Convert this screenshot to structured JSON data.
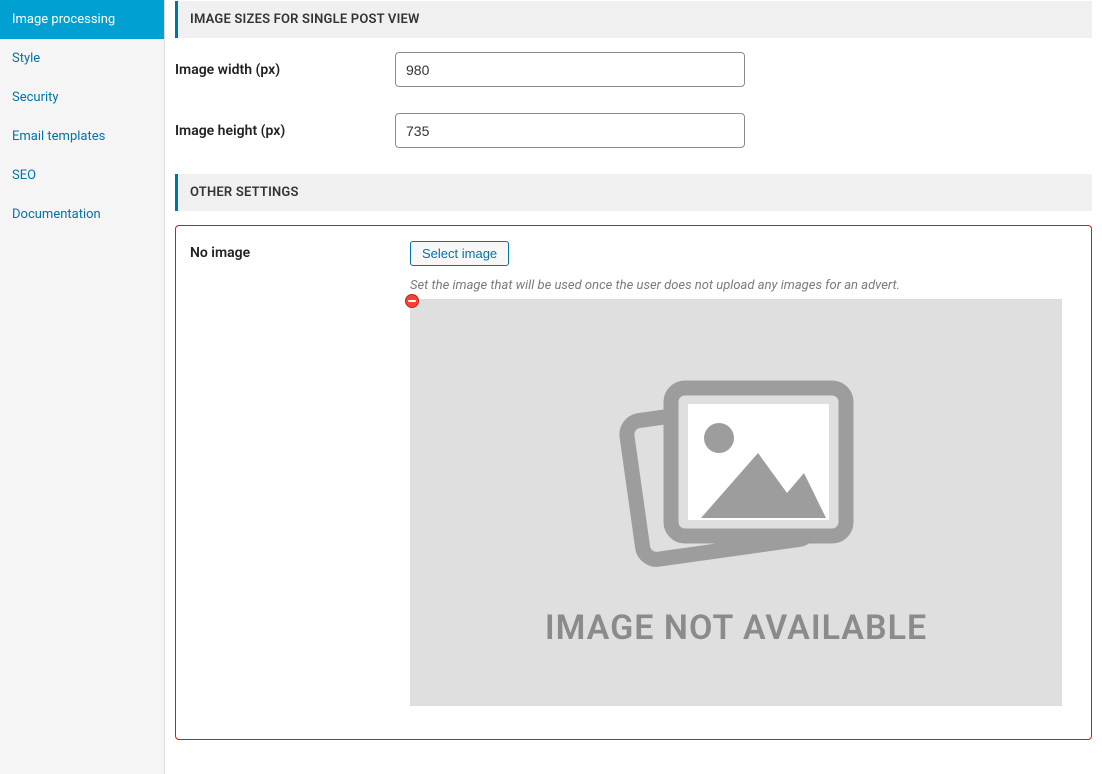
{
  "sidebar": {
    "items": [
      {
        "label": "Image processing",
        "active": true
      },
      {
        "label": "Style",
        "active": false
      },
      {
        "label": "Security",
        "active": false
      },
      {
        "label": "Email templates",
        "active": false
      },
      {
        "label": "SEO",
        "active": false
      },
      {
        "label": "Documentation",
        "active": false
      }
    ]
  },
  "sections": {
    "single_post": {
      "title": "IMAGE SIZES FOR SINGLE POST VIEW",
      "fields": {
        "width": {
          "label": "Image width (px)",
          "value": "980"
        },
        "height": {
          "label": "Image height (px)",
          "value": "735"
        }
      }
    },
    "other": {
      "title": "OTHER SETTINGS",
      "no_image": {
        "label": "No image",
        "button": "Select image",
        "help": "Set the image that will be used once the user does not upload any images for an advert.",
        "placeholder_text": "IMAGE NOT AVAILABLE"
      }
    }
  },
  "colors": {
    "accent": "#0073aa",
    "accent_bg": "#00a0d2",
    "danger_border": "#e81010"
  }
}
